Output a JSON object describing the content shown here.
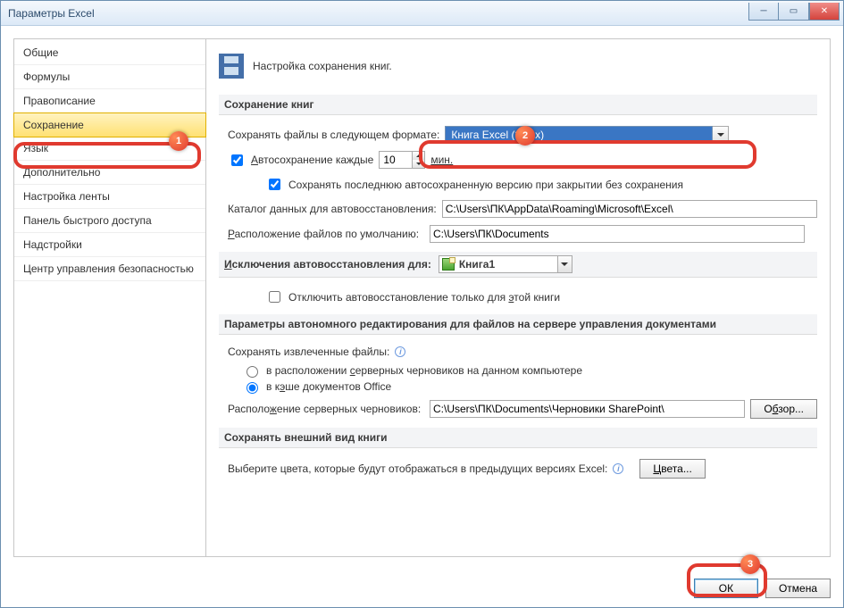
{
  "window": {
    "title": "Параметры Excel"
  },
  "sidebar": {
    "items": [
      {
        "label": "Общие"
      },
      {
        "label": "Формулы"
      },
      {
        "label": "Правописание"
      },
      {
        "label": "Сохранение",
        "selected": true
      },
      {
        "label": "Язык"
      },
      {
        "label": "Дополнительно"
      },
      {
        "label": "Настройка ленты"
      },
      {
        "label": "Панель быстрого доступа"
      },
      {
        "label": "Надстройки"
      },
      {
        "label": "Центр управления безопасностью"
      }
    ]
  },
  "header": {
    "subtitle": "Настройка сохранения книг."
  },
  "save_group": {
    "heading": "Сохранение книг",
    "format_label": "Сохранять файлы в следующем формате:",
    "format_value": "Книга Excel (*.xlsx)",
    "autosave_label": "Автосохранение каждые",
    "autosave_value": "10",
    "autosave_unit": "мин.",
    "autosave_checked": true,
    "keep_last_label": "Сохранять последнюю автосохраненную версию при закрытии без сохранения",
    "keep_last_checked": true,
    "autorecover_dir_label": "Каталог данных для автовосстановления:",
    "autorecover_dir_value": "C:\\Users\\ПК\\AppData\\Roaming\\Microsoft\\Excel\\",
    "default_dir_label": "Расположение файлов по умолчанию:",
    "default_dir_value": "C:\\Users\\ПК\\Documents"
  },
  "except_group": {
    "heading_prefix": "Исключения автовосстановления для:",
    "book_value": "Книга1",
    "disable_label": "Отключить автовосстановление только для этой книги",
    "disable_checked": false
  },
  "offline_group": {
    "heading": "Параметры автономного редактирования для файлов на сервере управления документами",
    "save_extracted_label": "Сохранять извлеченные файлы:",
    "option_server_drafts": "в расположении серверных черновиков на данном компьютере",
    "option_office_cache": "в кэше документов Office",
    "selected_option": "office_cache",
    "server_drafts_label": "Расположение серверных черновиков:",
    "server_drafts_value": "C:\\Users\\ПК\\Documents\\Черновики SharePoint\\",
    "browse_button": "Обзор..."
  },
  "appearance_group": {
    "heading": "Сохранять внешний вид книги",
    "colors_label": "Выберите цвета, которые будут отображаться в предыдущих версиях Excel:",
    "colors_button": "Цвета..."
  },
  "footer": {
    "ok": "ОК",
    "cancel": "Отмена"
  },
  "callouts": {
    "b1": "1",
    "b2": "2",
    "b3": "3"
  }
}
